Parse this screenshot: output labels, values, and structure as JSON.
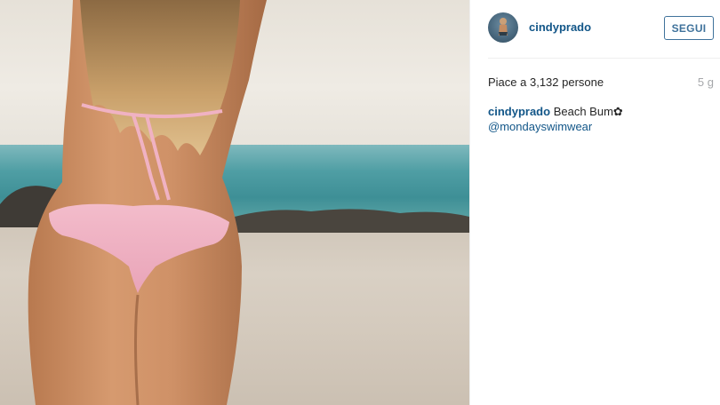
{
  "post": {
    "author": {
      "username": "cindyprado",
      "follow_label": "SEGUI"
    },
    "likes_text": "Piace a 3,132 persone",
    "timestamp": "5 g",
    "caption": {
      "username": "cindyprado",
      "text": "Beach Bum",
      "emoji": "✿",
      "mention": "@mondayswimwear"
    }
  },
  "colors": {
    "link": "#125688",
    "follow_border": "#3f729b",
    "meta_gray": "#a5a7aa",
    "divider": "#efefef"
  }
}
